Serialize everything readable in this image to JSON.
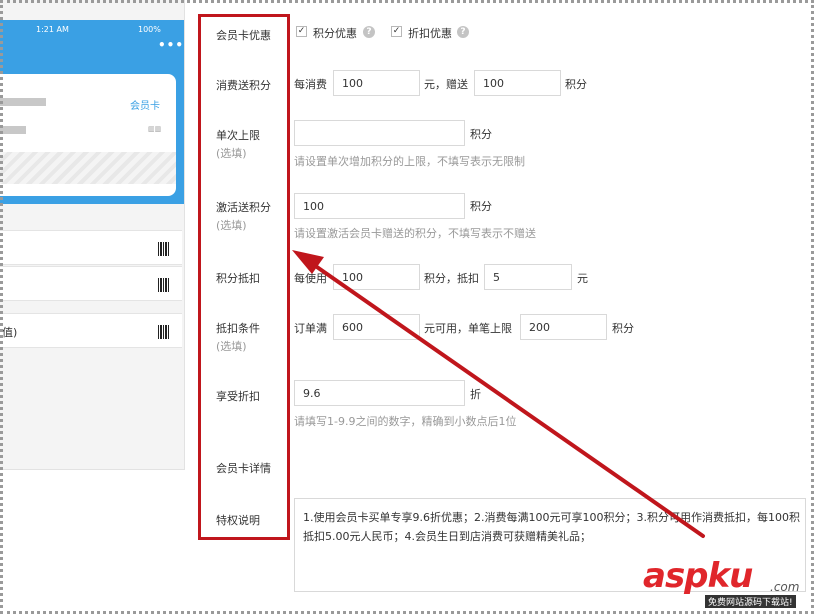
{
  "phone": {
    "time": "1:21 AM",
    "battery": "100%",
    "more": "•••",
    "card_type": "会员卡",
    "row_text": "值)"
  },
  "form": {
    "card_discount": {
      "label": "会员卡优惠",
      "points_discount": "积分优惠",
      "rebate_discount": "折扣优惠",
      "points_checked": true,
      "rebate_checked": true
    },
    "consume_points": {
      "label": "消费送积分",
      "prefix": "每消费",
      "amount": "100",
      "mid": "元，赠送",
      "points": "100",
      "suffix": "积分"
    },
    "single_limit": {
      "label": "单次上限",
      "optional": "(选填)",
      "value": "",
      "suffix": "积分",
      "hint": "请设置单次增加积分的上限，不填写表示无限制"
    },
    "activation_points": {
      "label": "激活送积分",
      "optional": "(选填)",
      "value": "100",
      "suffix": "积分",
      "hint": "请设置激活会员卡赠送的积分，不填写表示不赠送"
    },
    "points_deduct": {
      "label": "积分抵扣",
      "prefix": "每使用",
      "use_points": "100",
      "mid": "积分，抵扣",
      "deduct_amount": "5",
      "suffix": "元"
    },
    "deduct_condition": {
      "label": "抵扣条件",
      "optional": "(选填)",
      "prefix": "订单满",
      "order_min": "600",
      "mid": "元可用，单笔上限",
      "max_points": "200",
      "suffix": "积分"
    },
    "discount": {
      "label": "享受折扣",
      "value": "9.6",
      "suffix": "折",
      "hint": "请填写1-9.9之间的数字，精确到小数点后1位"
    },
    "card_details": {
      "label": "会员卡详情"
    },
    "privilege": {
      "label": "特权说明",
      "line1": "1.使用会员卡买单专享9.6折优惠；2.消费每满100元可享100积分；3.积分可用作消费抵扣，每100积",
      "line2": "抵扣5.00元人民币；4.会员生日到店消费可获赠精美礼品；"
    }
  },
  "watermark": {
    "brand": "aspku",
    "domain": ".com",
    "sub": "免费网站源码下载站!"
  },
  "colors": {
    "accent_blue": "#3aa0e4",
    "annotation_red": "#c0161c"
  }
}
